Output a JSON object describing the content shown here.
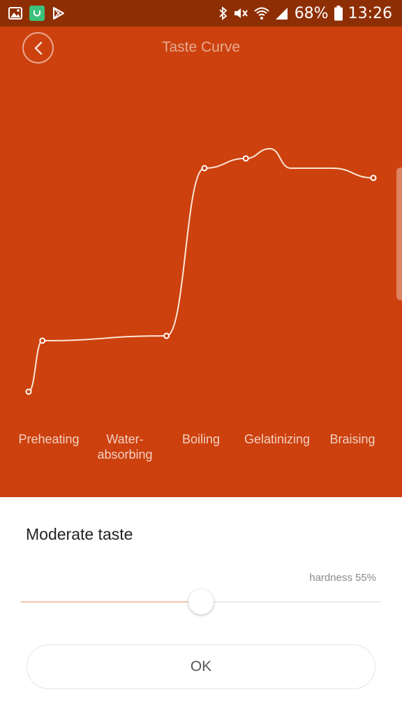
{
  "status_bar": {
    "battery": "68%",
    "time": "13:26",
    "left_icons": [
      "gallery-icon",
      "mi-home-icon",
      "play-store-icon"
    ],
    "right_icons": [
      "bluetooth-icon",
      "mute-icon",
      "wifi-icon",
      "signal-icon",
      "battery-icon"
    ]
  },
  "header": {
    "title": "Taste Curve",
    "back_icon": "chevron-left-icon",
    "background": "#cc410d"
  },
  "chart_data": {
    "type": "line",
    "title": "",
    "xlabel": "",
    "ylabel": "",
    "categories": [
      "Preheating",
      "Water-absorbing",
      "Boiling",
      "Gelatinizing",
      "Braising"
    ],
    "series": [
      {
        "values": [
          {
            "t": 0.0,
            "v": 0.0
          },
          {
            "t": 0.04,
            "v": 0.21
          },
          {
            "t": 0.4,
            "v": 0.23
          },
          {
            "t": 0.51,
            "v": 0.92
          },
          {
            "t": 0.63,
            "v": 0.96
          },
          {
            "t": 0.7,
            "v": 1.0
          },
          {
            "t": 0.76,
            "v": 0.92
          },
          {
            "t": 0.88,
            "v": 0.92
          },
          {
            "t": 1.0,
            "v": 0.88
          }
        ]
      }
    ],
    "markers": [
      0,
      1,
      2,
      3,
      4,
      8
    ],
    "line_color": "#fde6d8",
    "grid": false,
    "legend": "none"
  },
  "panel": {
    "taste_title": "Moderate taste",
    "hardness_prefix": "hardness",
    "hardness_value": "55%",
    "hardness_fraction": 0.5,
    "ok_label": "OK",
    "accent": "#f3c6a8"
  }
}
